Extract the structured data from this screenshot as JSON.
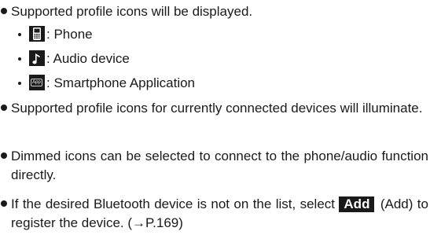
{
  "bullets": {
    "profile_icons": "Supported profile icons will be displayed.",
    "illuminate": "Supported profile icons for currently connected devices will illuminate.",
    "dimmed": "Dimmed icons can be selected to connect to the phone/audio function directly.",
    "add_prefix": "If the desired Bluetooth device is not on the list, select",
    "add_suffix": "(Add) to register the device. (→P.169)"
  },
  "sub_items": [
    {
      "icon": "phone-icon",
      "label": ": Phone"
    },
    {
      "icon": "music-note-icon",
      "label": ": Audio device"
    },
    {
      "icon": "app-icon",
      "label": ": Smartphone Application",
      "icon_text": "App"
    }
  ],
  "add_button": {
    "label": "Add"
  },
  "colors": {
    "text": "#1a1a1a",
    "icon_bg": "#1a1a1a",
    "icon_fg": "#ffffff"
  }
}
